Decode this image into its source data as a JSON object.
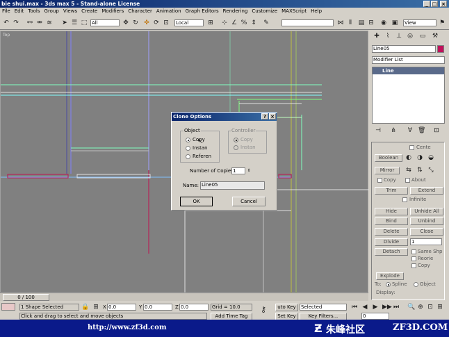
{
  "window": {
    "title": "bie shui.max - 3ds max 5 - Stand-alone License",
    "buttons": {
      "minimize": "_",
      "maximize": "□",
      "close": "×"
    }
  },
  "menu": [
    "File",
    "Edit",
    "Tools",
    "Group",
    "Views",
    "Create",
    "Modifiers",
    "Character",
    "Animation",
    "Graph Editors",
    "Rendering",
    "Customize",
    "MAXScript",
    "Help"
  ],
  "toolbar": {
    "selection_filter": "All",
    "coord_system": "Local",
    "view_dropdown": "View"
  },
  "viewport": {
    "label": "Top"
  },
  "command_panel": {
    "object_name": "Line05",
    "object_color": "#c0105a",
    "modifier_list": "Modifier List",
    "stack_item": "Line",
    "rollout": {
      "center_label": "Cente",
      "boolean_label": "Boolean",
      "mirror_label": "Mirror",
      "copy_label": "Copy",
      "about_label": "About",
      "trim_label": "Trim",
      "extend_label": "Extend",
      "infinite_label": "Infinite",
      "hide_label": "Hide",
      "unhide_all_label": "Unhide All",
      "bind_label": "Bind",
      "unbind_label": "Unbind",
      "delete_label": "Delete",
      "close_label": "Close",
      "divide_label": "Divide",
      "divide_value": "1",
      "detach_label": "Detach",
      "same_shp_label": "Same Shp",
      "reorie_label": "Reorie",
      "copy2_label": "Copy",
      "explode_label": "Explode",
      "to_label": "To:",
      "spline_label": "Spline",
      "object_label": "Object",
      "display_label": "Display:"
    }
  },
  "clone_dialog": {
    "title": "Clone Options",
    "help_btn": "?",
    "close_btn": "×",
    "object_group": "Object",
    "object_options": [
      "Copy",
      "Instan",
      "Referen"
    ],
    "controller_group": "Controller",
    "controller_options": [
      "Copy",
      "Instan"
    ],
    "copies_label": "Number of Copies:",
    "copies_value": "1",
    "name_label": "Name:",
    "name_value": "Line05",
    "ok_label": "OK",
    "cancel_label": "Cancel"
  },
  "timeline": {
    "frame": "0 / 100"
  },
  "status": {
    "selection": "1 Shape Selected",
    "x_label": "X",
    "x_value": "0.0",
    "y_label": "Y",
    "y_value": "0.0",
    "z_label": "Z",
    "z_value": "0.0",
    "grid": "Grid = 10.0",
    "auto_key": "uto Key",
    "set_key": "Set Key",
    "selected_dropdown": "Selected",
    "key_filters": "Key Filters...",
    "add_time_tag": "Add Time Tag",
    "prompt": "Click and drag to select and move objects",
    "frame_value": "0"
  },
  "watermark": {
    "url": "http://www.zf3d.com",
    "brand": "朱峰社区",
    "site": "ZF3D.COM"
  }
}
